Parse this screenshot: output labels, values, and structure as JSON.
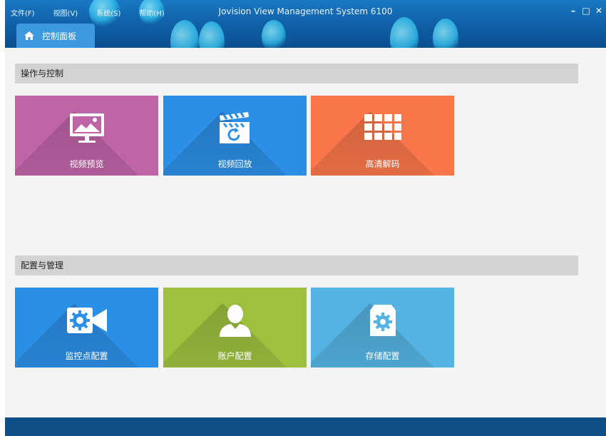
{
  "window": {
    "title": "Jovision View Management System 6100",
    "menu": [
      "文件(F)",
      "视图(V)",
      "系统(S)",
      "帮助(H)"
    ],
    "controls": {
      "minimize": "–",
      "maximize": "□",
      "close": "✕"
    }
  },
  "tab": {
    "label": "控制面板",
    "icon": "home-icon"
  },
  "sections": [
    {
      "title": "操作与控制",
      "tiles": [
        {
          "label": "视频预览",
          "icon": "monitor-image-icon",
          "color": "#c064a8"
        },
        {
          "label": "视频回放",
          "icon": "clapperboard-replay-icon",
          "color": "#2c8fe6"
        },
        {
          "label": "高清解码",
          "icon": "grid-icon",
          "color": "#f8764a"
        }
      ]
    },
    {
      "title": "配置与管理",
      "tiles": [
        {
          "label": "监控点配置",
          "icon": "camera-gear-icon",
          "color": "#2c8fe6"
        },
        {
          "label": "账户配置",
          "icon": "user-icon",
          "color": "#9dc13f"
        },
        {
          "label": "存储配置",
          "icon": "storage-gear-icon",
          "color": "#55b3e3"
        }
      ]
    }
  ],
  "colors": {
    "titlebar": "#0f5ea6",
    "statusbar": "#0d4f86",
    "section_header": "#d3d3d3"
  }
}
